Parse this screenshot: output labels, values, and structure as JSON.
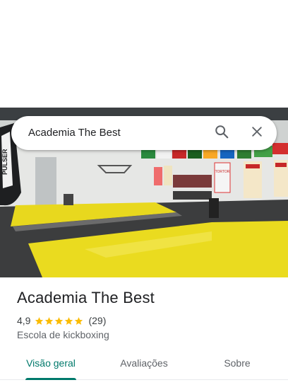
{
  "search": {
    "query": "Academia The Best",
    "search_icon": "search-icon",
    "close_icon": "close-icon"
  },
  "photo": {
    "bag_text": "PULSER",
    "poster_text": "TORTOR"
  },
  "place": {
    "name": "Academia The Best",
    "rating": "4,9",
    "stars": 5,
    "reviews": "(29)",
    "category": "Escola de kickboxing"
  },
  "tabs": [
    {
      "label": "Visão geral",
      "active": true
    },
    {
      "label": "Avaliações",
      "active": false
    },
    {
      "label": "Sobre",
      "active": false
    }
  ],
  "colors": {
    "accent": "#00796b",
    "star": "#fbbc04",
    "mat_yellow": "#e8d81e"
  }
}
